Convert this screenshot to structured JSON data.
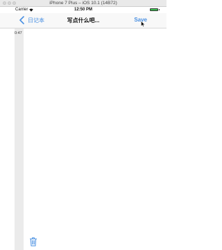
{
  "window": {
    "title": "iPhone 7 Plus – iOS 10.1 (14B72)"
  },
  "status_bar": {
    "carrier": "Carrier",
    "time": "12:50 PM",
    "battery_level": 1.0,
    "battery_color": "#3dc251"
  },
  "nav": {
    "back_label": "日记本",
    "title": "写点什么吧...",
    "save_label": "Save",
    "accent_color": "#4a90e2"
  },
  "editor": {
    "timestamp": "0:47",
    "content": ""
  },
  "toolbar": {
    "trash_icon": "trash-icon"
  }
}
